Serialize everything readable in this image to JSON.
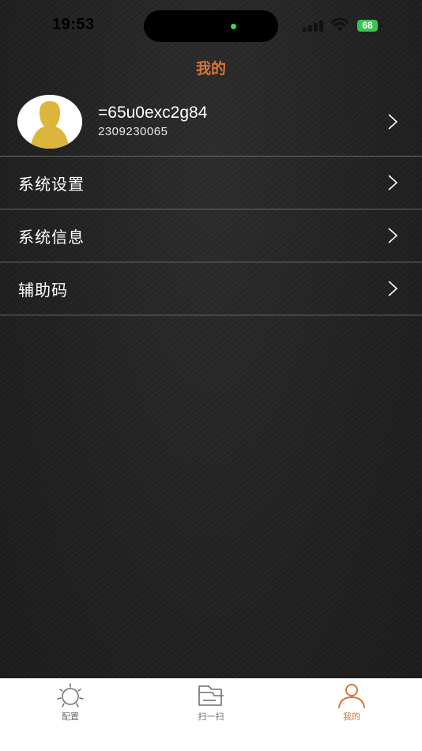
{
  "status_bar": {
    "time": "19:53",
    "battery": "68"
  },
  "header": {
    "title": "我的"
  },
  "profile": {
    "name": "=65u0exc2g84",
    "id": "2309230065"
  },
  "menu": [
    {
      "label": "系统设置"
    },
    {
      "label": "系统信息"
    },
    {
      "label": "辅助码"
    }
  ],
  "tabbar": {
    "tabs": [
      {
        "label": "配置",
        "icon": "sun-gear-icon",
        "active": false
      },
      {
        "label": "扫一扫",
        "icon": "scan-icon",
        "active": false
      },
      {
        "label": "我的",
        "icon": "person-icon",
        "active": true
      }
    ]
  },
  "colors": {
    "accent": "#d8743a",
    "background": "#222222",
    "divider": "#6a6a6a",
    "avatar": "#dcb63c"
  }
}
